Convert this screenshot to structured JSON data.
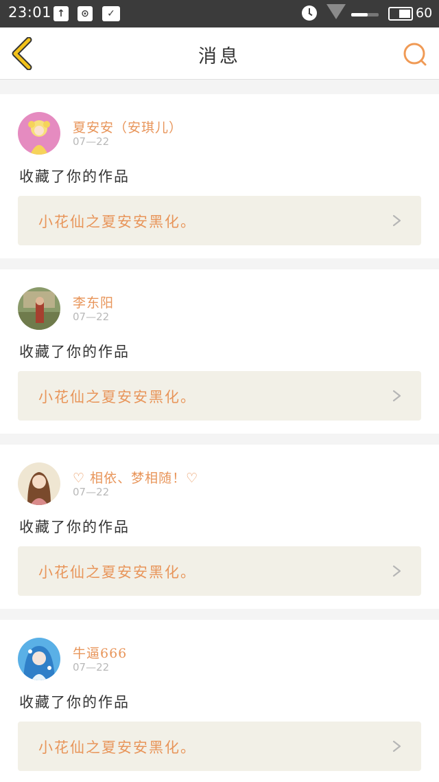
{
  "status_bar": {
    "time": "23:01",
    "battery": "60",
    "icons": [
      "upload-icon",
      "hotspot-icon",
      "screenshot-icon",
      "alarm-icon",
      "wifi-icon",
      "signal-icon",
      "battery-icon"
    ]
  },
  "header": {
    "title": "消息",
    "back_icon": "chevron-left-icon",
    "search_icon": "search-icon"
  },
  "colors": {
    "accent_orange": "#e8955a",
    "back_yellow": "#f2c21b",
    "card_link_bg": "#f2f0e7",
    "status_bar_bg": "#3b3b3b"
  },
  "messages": [
    {
      "username": "夏安安（安琪儿）",
      "date": "07—22",
      "text": "收藏了你的作品",
      "work_title": "小花仙之夏安安黑化。"
    },
    {
      "username": "李东阳",
      "date": "07—22",
      "text": "收藏了你的作品",
      "work_title": "小花仙之夏安安黑化。"
    },
    {
      "username": "♡ 相依、梦相随！♡",
      "date": "07—22",
      "text": "收藏了你的作品",
      "work_title": "小花仙之夏安安黑化。"
    },
    {
      "username": "牛逼666",
      "date": "07—22",
      "text": "收藏了你的作品",
      "work_title": "小花仙之夏安安黑化。"
    }
  ]
}
